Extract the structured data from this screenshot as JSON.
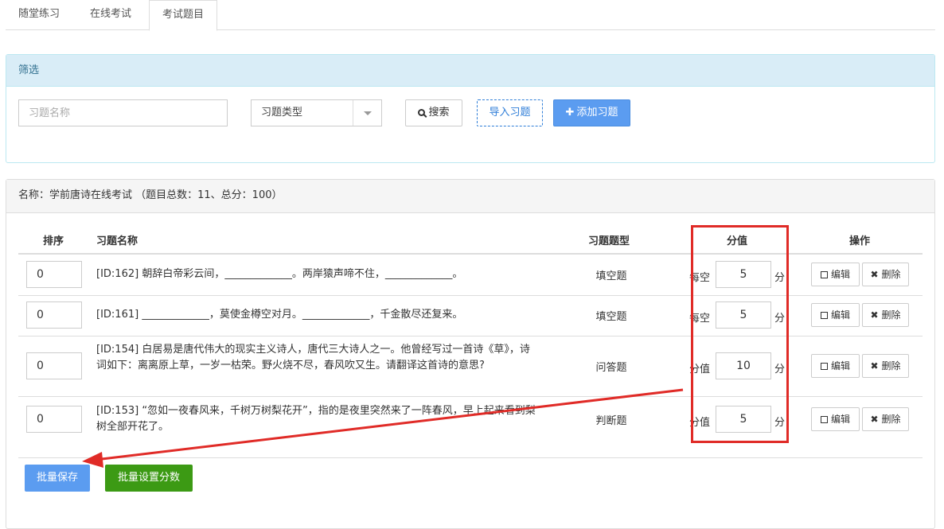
{
  "tabs": [
    "随堂练习",
    "在线考试",
    "考试题目"
  ],
  "filter": {
    "title": "筛选",
    "name_placeholder": "习题名称",
    "type_select": "习题类型",
    "search_label": "搜索",
    "import_label": "导入习题",
    "add_label": "添加习题"
  },
  "exam": {
    "header": "名称：学前唐诗在线考试 （题目总数：11、总分：100）",
    "columns": {
      "order": "排序",
      "name": "习题名称",
      "type": "习题题型",
      "score": "分值",
      "actions": "操作"
    },
    "rows": [
      {
        "order": "0",
        "text": "[ID:162] 朝辞白帝彩云间，_____________。两岸猿声啼不住，_____________。",
        "type": "填空题",
        "score_label": "每空",
        "score": "5",
        "unit": "分",
        "edit": "编辑",
        "delete": "删除"
      },
      {
        "order": "0",
        "text": "[ID:161] _____________，莫使金樽空对月。_____________，千金散尽还复来。",
        "type": "填空题",
        "score_label": "每空",
        "score": "5",
        "unit": "分",
        "edit": "编辑",
        "delete": "删除"
      },
      {
        "order": "0",
        "text": "[ID:154] 白居易是唐代伟大的现实主义诗人，唐代三大诗人之一。他曾经写过一首诗《草》，诗词如下：离离原上草，一岁一枯荣。野火烧不尽，春风吹又生。请翻译这首诗的意思?",
        "type": "问答题",
        "score_label": "分值",
        "score": "10",
        "unit": "分",
        "edit": "编辑",
        "delete": "删除"
      },
      {
        "order": "0",
        "text": "[ID:153] “忽如一夜春风来，千树万树梨花开”，指的是夜里突然来了一阵春风，早上起来看到梨树全部开花了。",
        "type": "判断题",
        "score_label": "分值",
        "score": "5",
        "unit": "分",
        "edit": "编辑",
        "delete": "删除"
      }
    ],
    "bulk_save": "批量保存",
    "bulk_score": "批量设置分数"
  },
  "colors": {
    "primary": "#5b9cf0",
    "success": "#3c9a14",
    "filter_heading_bg": "#d9edf7",
    "annotation": "#e02b27"
  }
}
